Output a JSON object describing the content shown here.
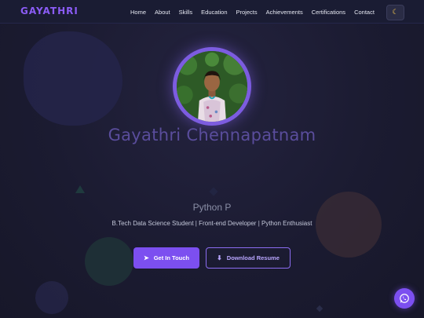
{
  "brand": "GAYATHRI",
  "nav": [
    "Home",
    "About",
    "Skills",
    "Education",
    "Projects",
    "Achievements",
    "Certifications",
    "Contact"
  ],
  "theme_toggle_icon": "moon-icon",
  "hero": {
    "name": "Gayathri Chennapatnam",
    "role": "Python P",
    "tagline": "B.Tech Data Science Student | Front-end Developer | Python Enthusiast"
  },
  "buttons": {
    "contact": "Get In Touch",
    "contact_icon": "paper-plane-icon",
    "resume": "Download Resume",
    "resume_icon": "download-icon"
  },
  "chat_icon": "whatsapp-icon",
  "colors": {
    "accent": "#7c4ff0",
    "background": "#1b1b31",
    "navbar": "#1a1c33"
  }
}
